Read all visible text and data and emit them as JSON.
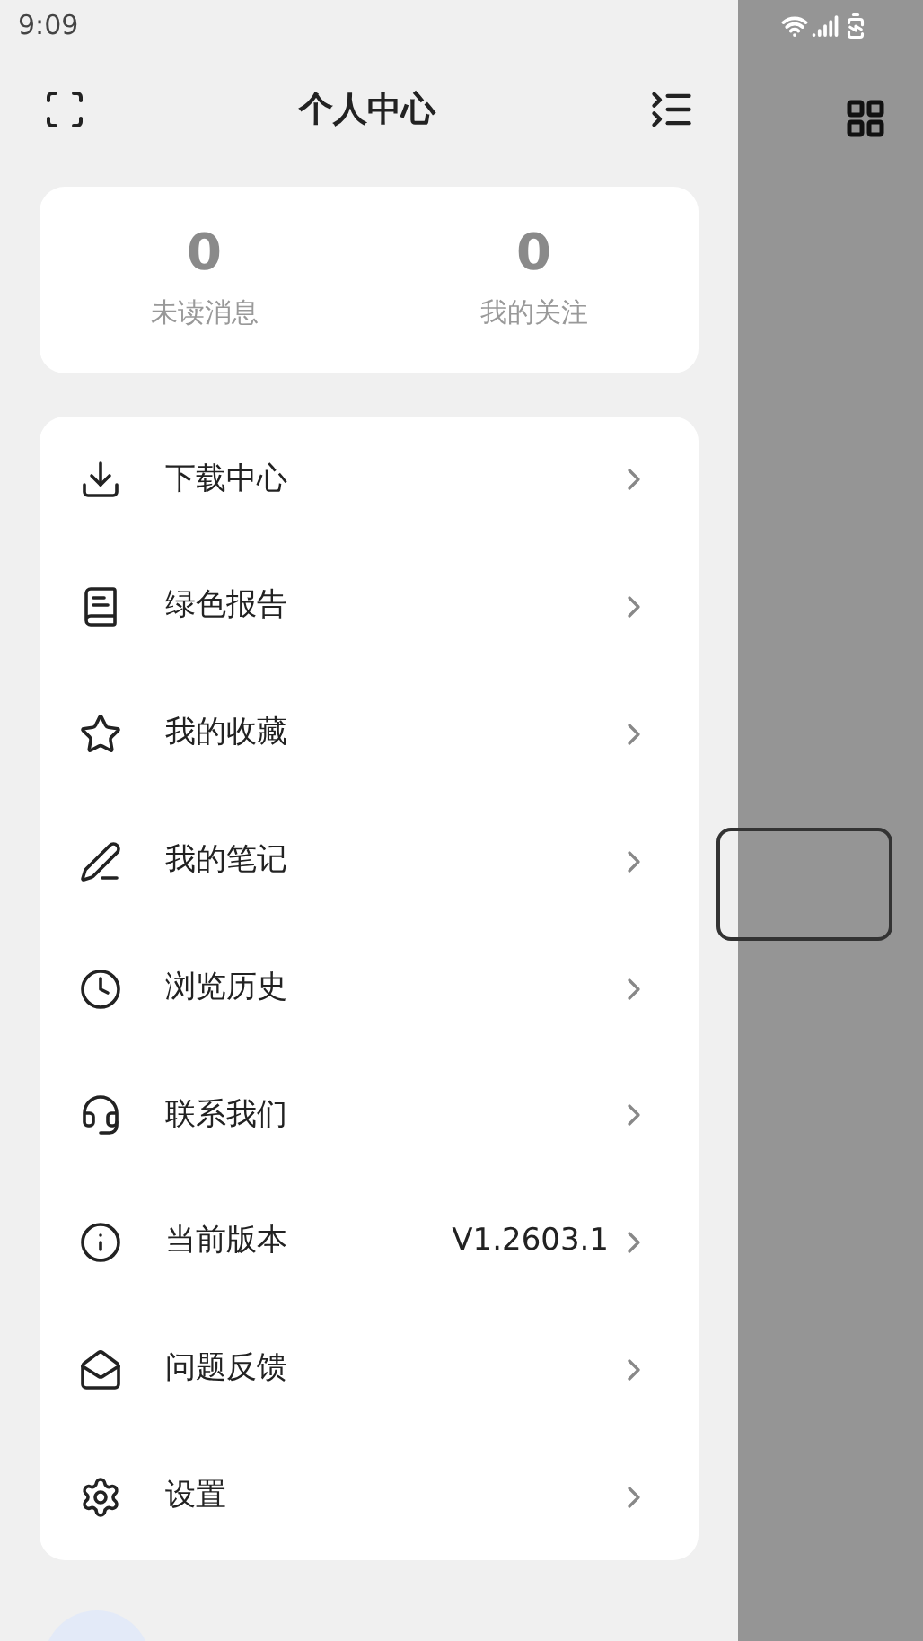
{
  "status_bar": {
    "time": "9:09"
  },
  "header": {
    "title": "个人中心"
  },
  "stats": [
    {
      "value": "0",
      "label": "未读消息"
    },
    {
      "value": "0",
      "label": "我的关注"
    }
  ],
  "menu": [
    {
      "label": "下载中心"
    },
    {
      "label": "绿色报告"
    },
    {
      "label": "我的收藏"
    },
    {
      "label": "我的笔记"
    },
    {
      "label": "浏览历史"
    },
    {
      "label": "联系我们"
    },
    {
      "label": "当前版本",
      "value": "V1.2603.1"
    },
    {
      "label": "问题反馈"
    },
    {
      "label": "设置"
    }
  ]
}
